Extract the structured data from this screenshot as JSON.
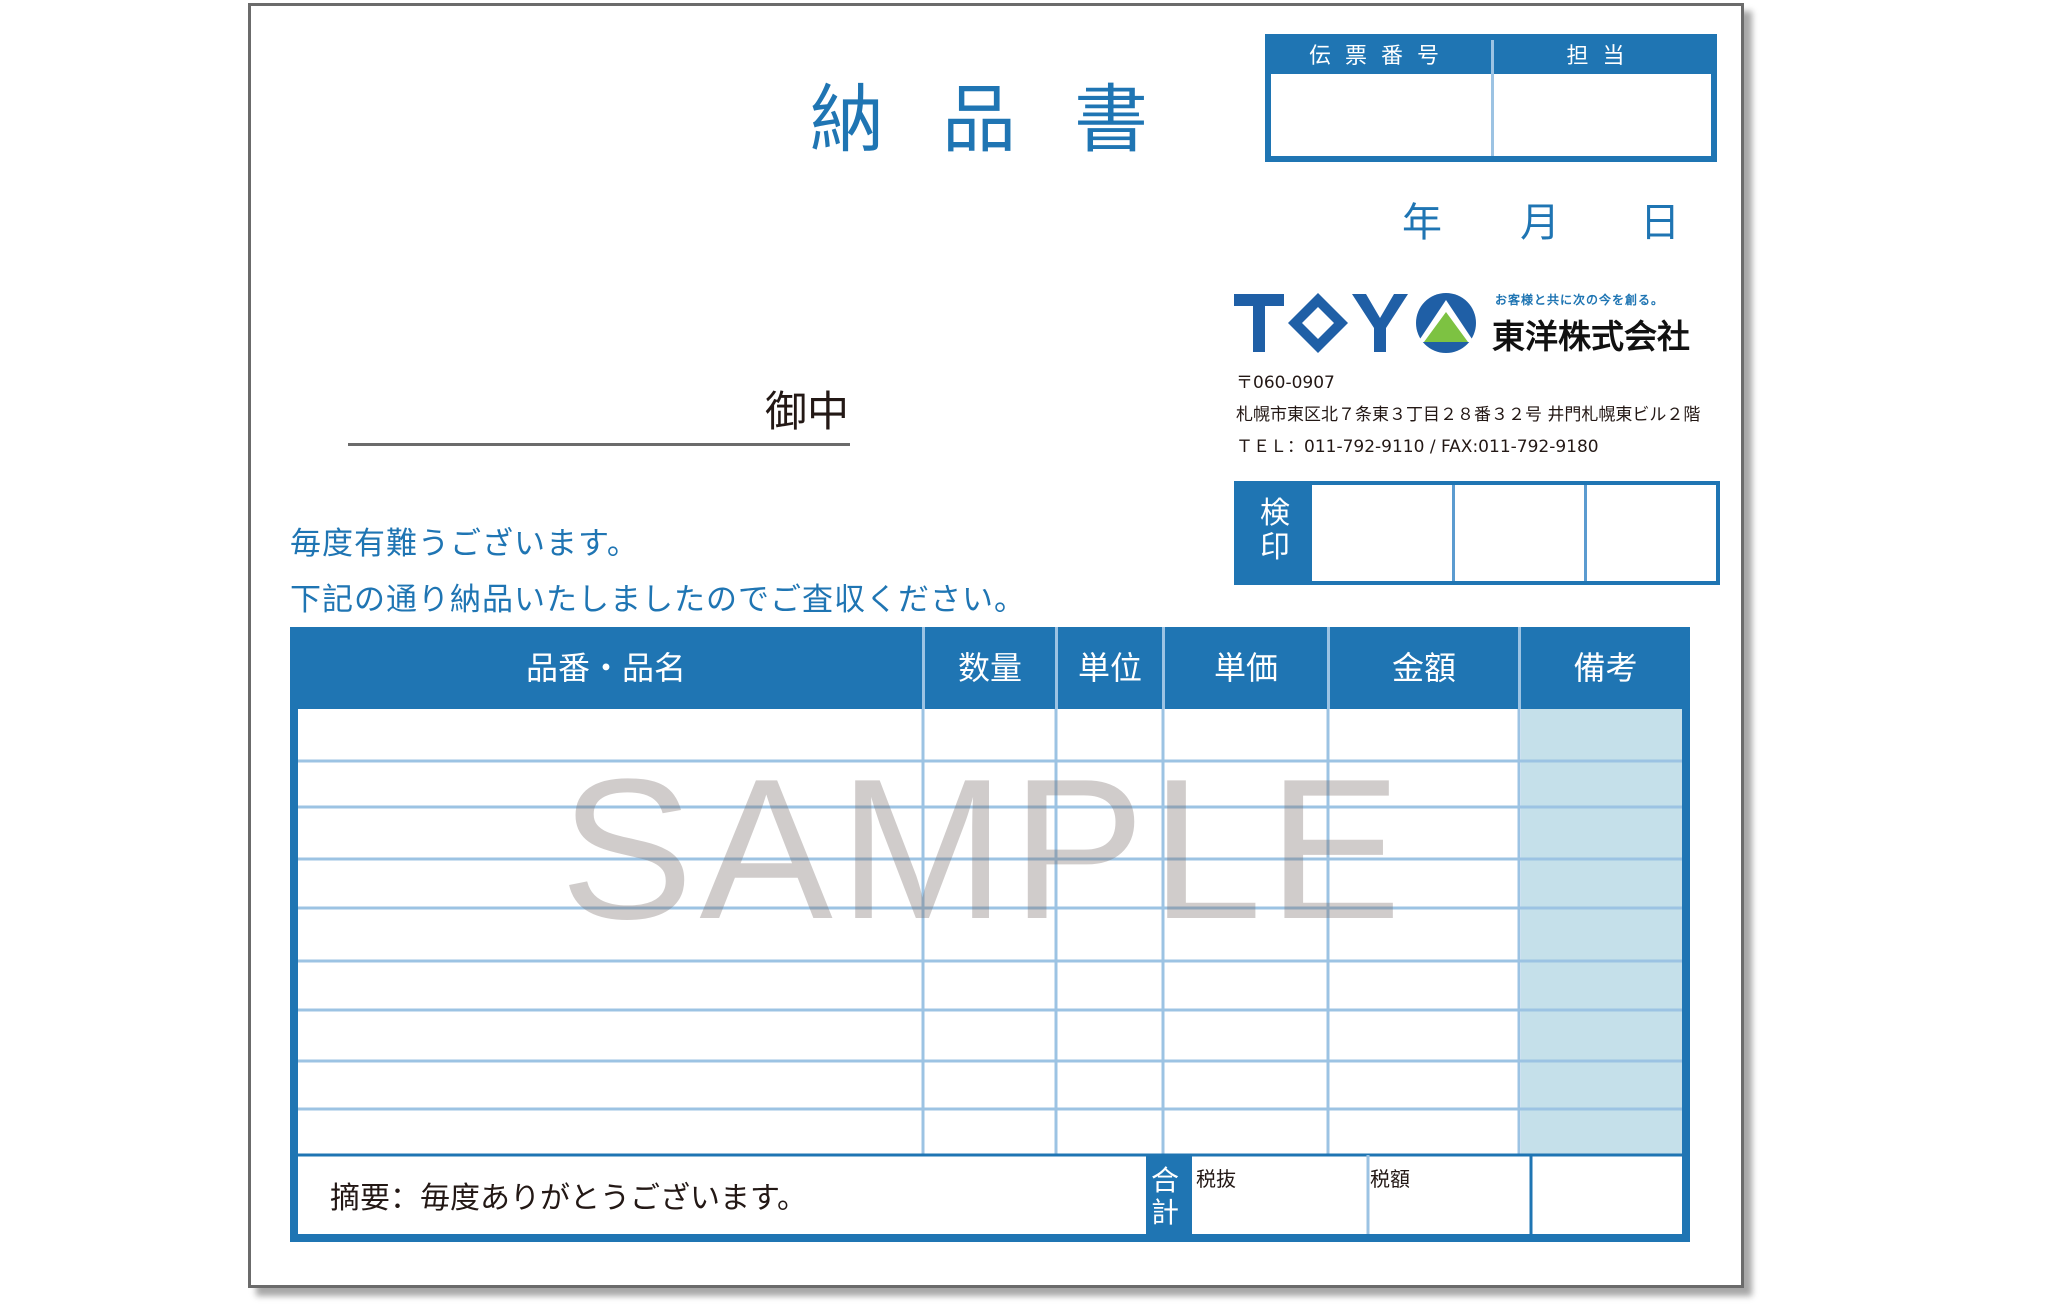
{
  "title": "納品書",
  "slip": {
    "number_label": "伝票番号",
    "staff_label": "担当"
  },
  "date": {
    "year": "年",
    "month": "月",
    "day": "日"
  },
  "company": {
    "logo_text": "TOYO",
    "tagline": "お客様と共に次の今を創る。",
    "name": "東洋株式会社",
    "postal": "〒060-0907",
    "address": "札幌市東区北７条東３丁目２８番３２号 井門札幌東ビル２階",
    "tel": "ＴＥＬ：011-792-9110 / FAX:011-792-9180",
    "colors": {
      "navy": "#1f5fa6",
      "green": "#7dc242"
    }
  },
  "recipient_suffix": "御中",
  "greeting": {
    "line1": "毎度有難うございます。",
    "line2": "下記の通り納品いたしましたのでご査収ください。"
  },
  "inspection_label": "検印",
  "table": {
    "headers": [
      "品番・品名",
      "数量",
      "単位",
      "単価",
      "金額",
      "備考"
    ],
    "row_count": 9
  },
  "watermark": "SAMPLE",
  "footer": {
    "summary": "摘要：毎度ありがとうございます。",
    "total_label": "合計",
    "pre_tax_label": "税抜",
    "tax_label": "税額"
  },
  "colors": {
    "accent": "#1f75b3",
    "light_line": "#9cc3e3",
    "remarks_fill": "#c5e0ea"
  }
}
